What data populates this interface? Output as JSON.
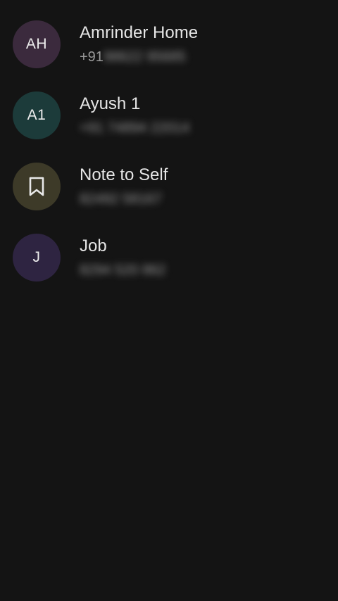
{
  "contacts": [
    {
      "initials": "AH",
      "name": "Amrinder Home",
      "number_visible": "+91",
      "number_obscured": "98622 95685",
      "avatar_color": "#3b2a3d"
    },
    {
      "initials": "A1",
      "name": "Ayush 1",
      "number_visible": "",
      "number_obscured": "+91 74894 22014",
      "avatar_color": "#1c3b3a"
    },
    {
      "initials": "",
      "icon": "bookmark-icon",
      "name": "Note to Self",
      "number_visible": "",
      "number_obscured": "82492 58167",
      "avatar_color": "#3d3a28"
    },
    {
      "initials": "J",
      "name": "Job",
      "number_visible": "",
      "number_obscured": "8294 520 862",
      "avatar_color": "#2e2441"
    }
  ]
}
